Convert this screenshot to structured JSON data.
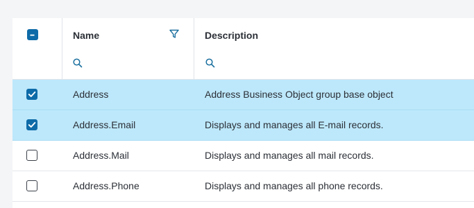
{
  "header": {
    "select_all_state": "indeterminate",
    "columns": [
      {
        "label": "Name",
        "has_filter": true,
        "has_search": true
      },
      {
        "label": "Description",
        "has_filter": false,
        "has_search": true
      }
    ]
  },
  "rows": [
    {
      "name": "Address",
      "description": "Address Business Object group base object",
      "selected": true
    },
    {
      "name": "Address.Email",
      "description": "Displays and manages all E-mail records.",
      "selected": true
    },
    {
      "name": "Address.Mail",
      "description": "Displays and manages all mail records.",
      "selected": false
    },
    {
      "name": "Address.Phone",
      "description": "Displays and manages all phone records.",
      "selected": false
    }
  ],
  "colors": {
    "accent": "#0e6ba8",
    "selected_row": "#bde8fb",
    "icon": "#1a6f9e"
  },
  "icons": [
    "minus-checkbox-icon",
    "check-icon",
    "filter-icon",
    "search-icon"
  ]
}
